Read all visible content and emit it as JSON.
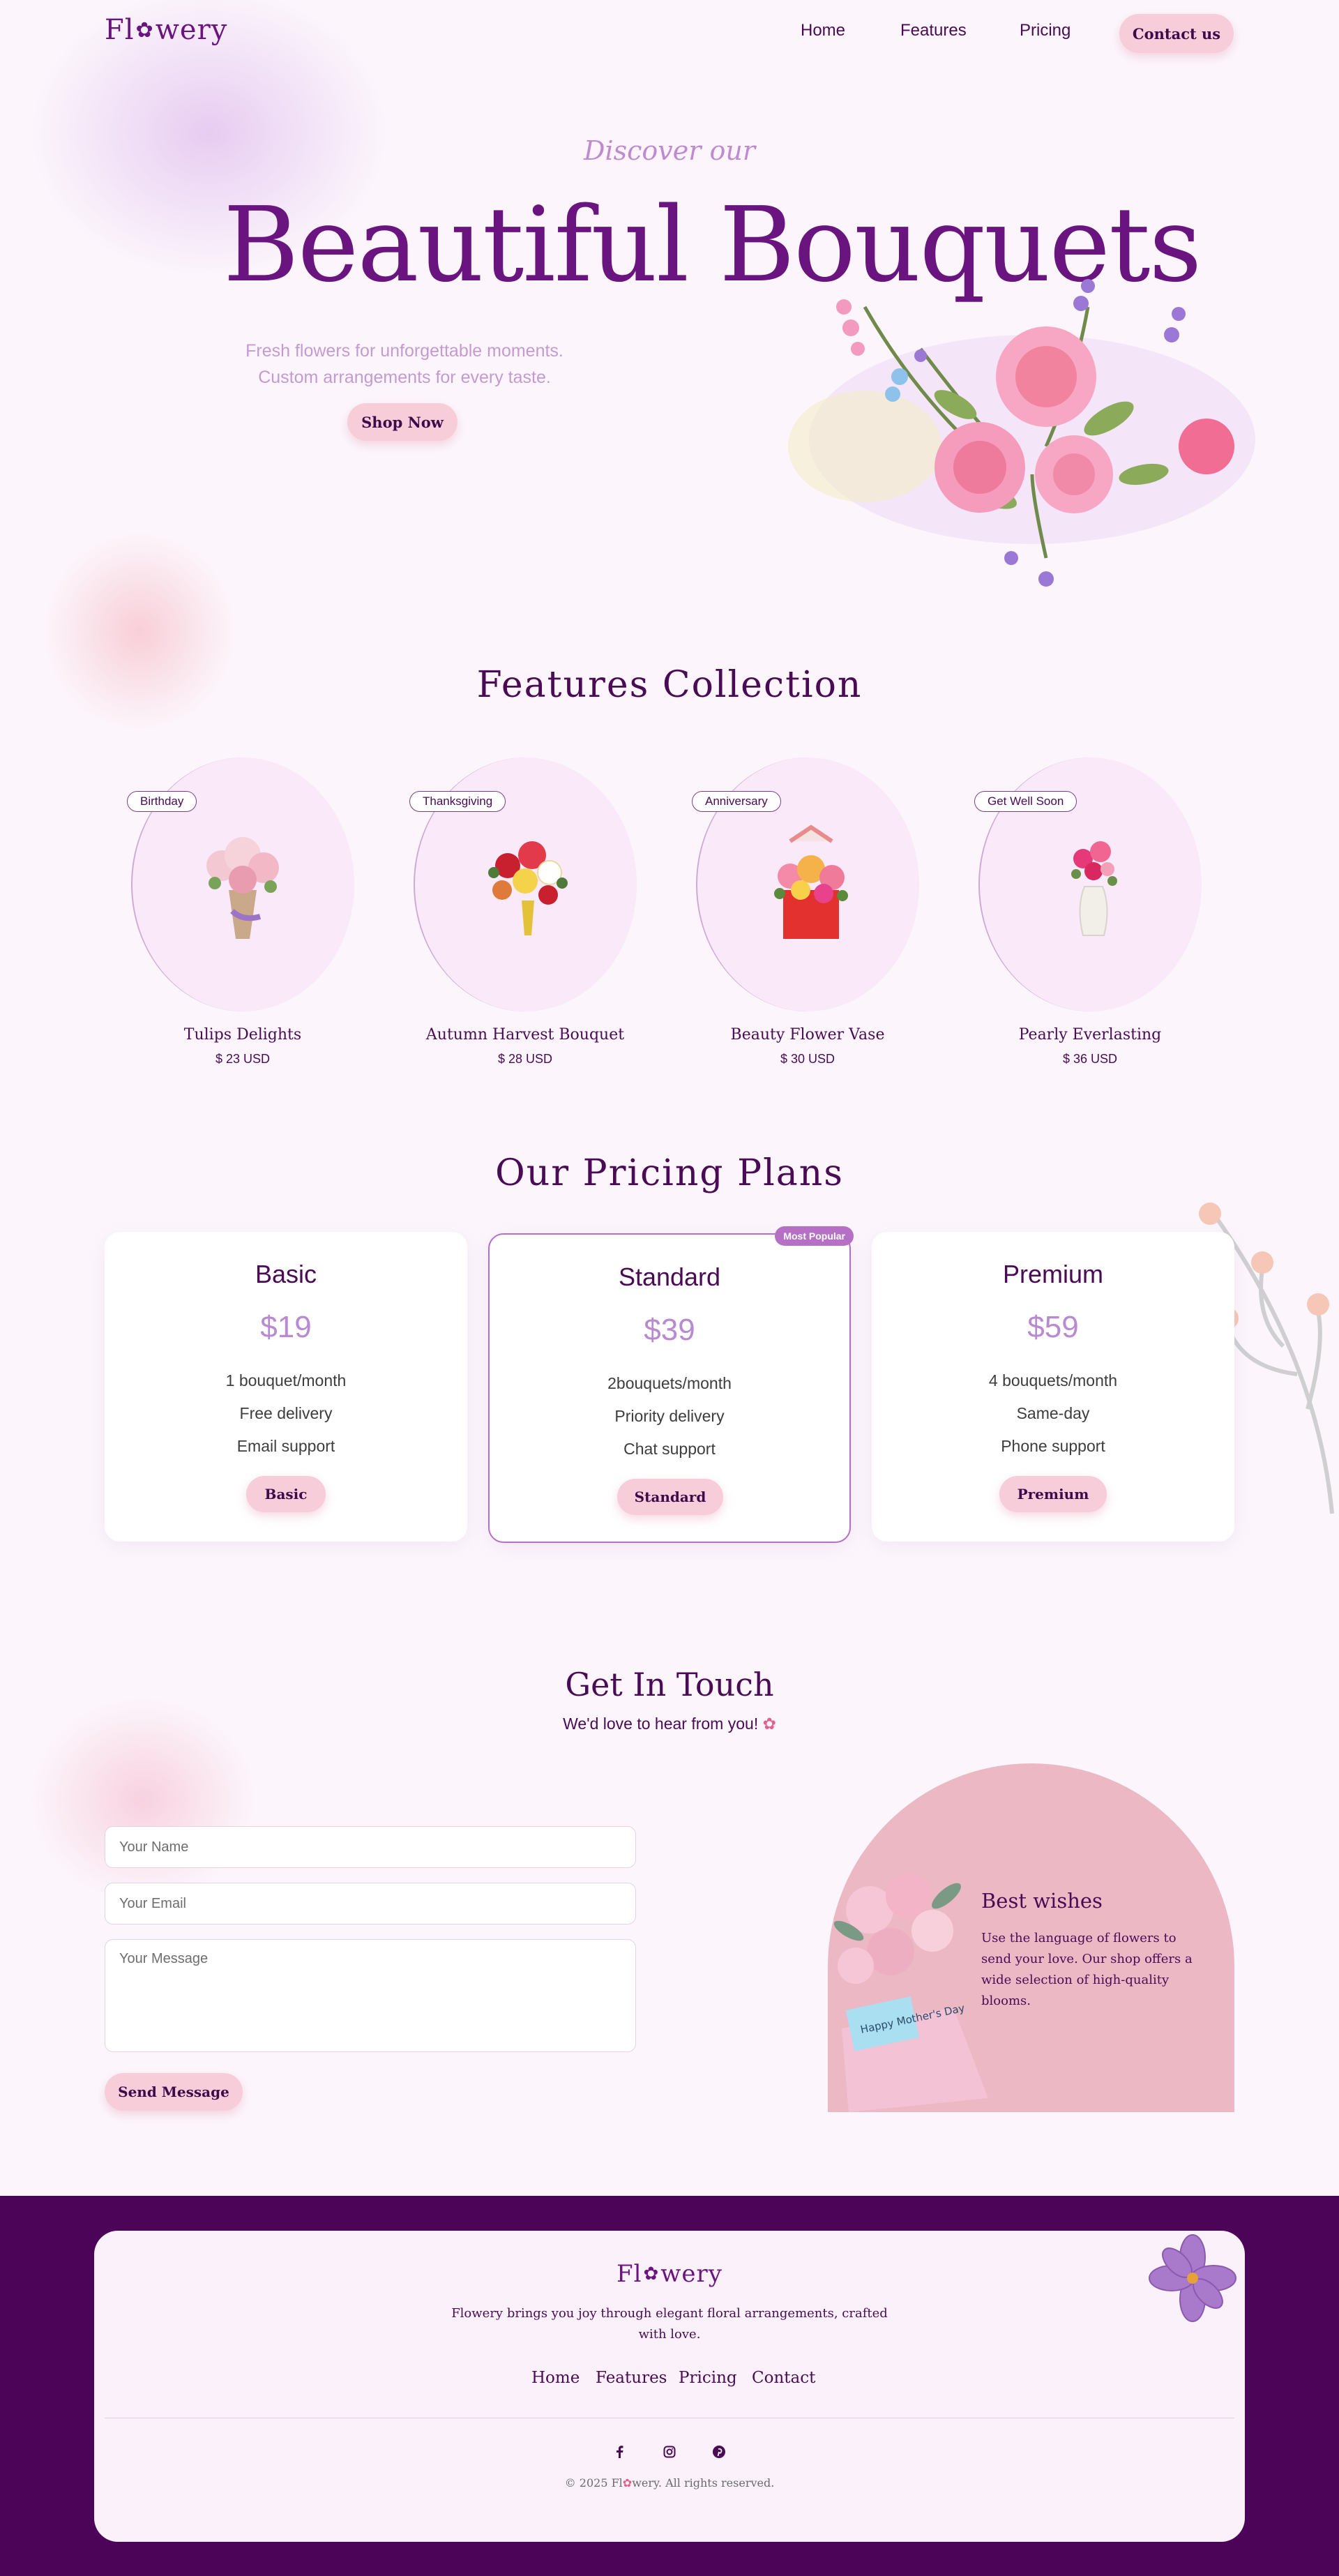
{
  "nav": {
    "logo_left": "Fl",
    "logo_right": "wery",
    "links": [
      "Home",
      "Features",
      "Pricing"
    ],
    "contact_label": "Contact us"
  },
  "hero": {
    "eyebrow": "Discover our",
    "title": "Beautiful Bouquets",
    "subtitle_line1": "Fresh flowers for unforgettable moments.",
    "subtitle_line2": "Custom arrangements for every taste.",
    "cta_label": "Shop Now"
  },
  "features": {
    "title": "Features Collection",
    "cards": [
      {
        "tag": "Birthday",
        "name": "Tulips Delights",
        "price": "$ 23 USD"
      },
      {
        "tag": "Thanksgiving",
        "name": "Autumn Harvest Bouquet",
        "price": "$ 28 USD"
      },
      {
        "tag": "Anniversary",
        "name": "Beauty Flower Vase",
        "price": "$ 30 USD"
      },
      {
        "tag": "Get Well Soon",
        "name": "Pearly Everlasting",
        "price": "$ 36 USD"
      }
    ]
  },
  "pricing": {
    "title": "Our Pricing Plans",
    "badge": "Most Popular",
    "plans": [
      {
        "name": "Basic",
        "price": "$19",
        "features": [
          "1 bouquet/month",
          "Free delivery",
          "Email support"
        ],
        "button": "Basic"
      },
      {
        "name": "Standard",
        "price": "$39",
        "features": [
          "2bouquets/month",
          "Priority delivery",
          "Chat support"
        ],
        "button": "Standard"
      },
      {
        "name": "Premium",
        "price": "$59",
        "features": [
          "4 bouquets/month",
          "Same-day",
          "Phone support"
        ],
        "button": "Premium"
      }
    ]
  },
  "contact": {
    "title": "Get In Touch",
    "subtitle": "We'd love to hear from you!",
    "name_placeholder": "Your Name",
    "email_placeholder": "Your Email",
    "message_placeholder": "Your Message",
    "send_label": "Send Message",
    "card_title": "Best wishes",
    "card_text": "Use the language of flowers to send your love. Our shop offers a wide selection of high-quality blooms.",
    "card_note": "Happy Mother's Day"
  },
  "footer": {
    "logo_left": "Fl",
    "logo_right": "wery",
    "tagline": "Flowery brings you joy through elegant floral arrangements, crafted with love.",
    "links": [
      "Home",
      "Features",
      "Pricing",
      "Contact"
    ],
    "social_icons": [
      "facebook-icon",
      "instagram-icon",
      "pinterest-icon"
    ],
    "copyright_left": "© 2025 Fl",
    "copyright_right": "wery. All rights reserved."
  }
}
